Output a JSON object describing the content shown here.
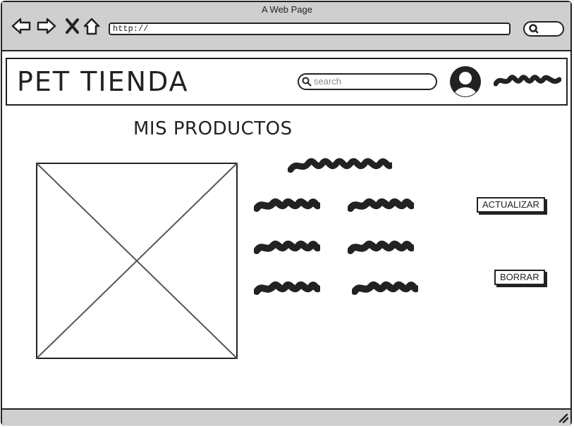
{
  "browser": {
    "window_title": "A Web Page",
    "url": "http://"
  },
  "header": {
    "brand": "PET TIENDA",
    "search_placeholder": "search"
  },
  "main": {
    "title": "MIS PRODUCTOS",
    "buttons": {
      "update": "ACTUALIZAR",
      "delete": "BORRAR"
    }
  }
}
